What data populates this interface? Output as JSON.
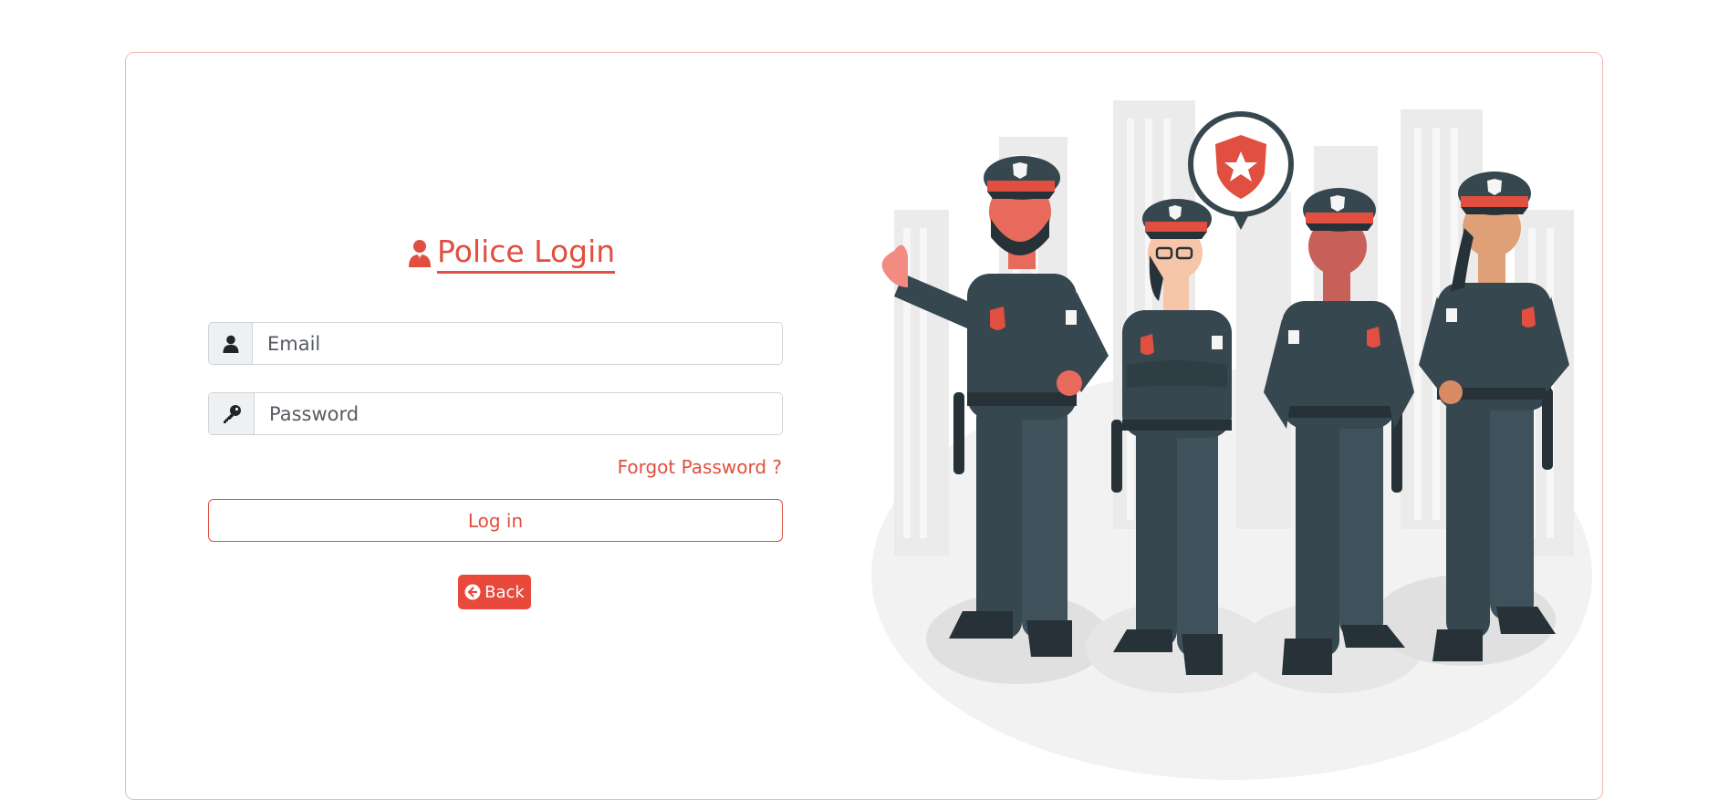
{
  "login": {
    "title": "Police Login",
    "email_placeholder": "Email",
    "password_placeholder": "Password",
    "forgot_label": "Forgot Password ?",
    "login_label": "Log in",
    "back_label": "Back"
  },
  "icons": {
    "title": "police-officer-icon",
    "email": "user-icon",
    "password": "key-icon",
    "back": "arrow-circle-left-icon"
  },
  "colors": {
    "accent": "#e04f3f",
    "back_button": "#e8493b",
    "uniform": "#37474f",
    "card_border": "#f0b9b0"
  }
}
